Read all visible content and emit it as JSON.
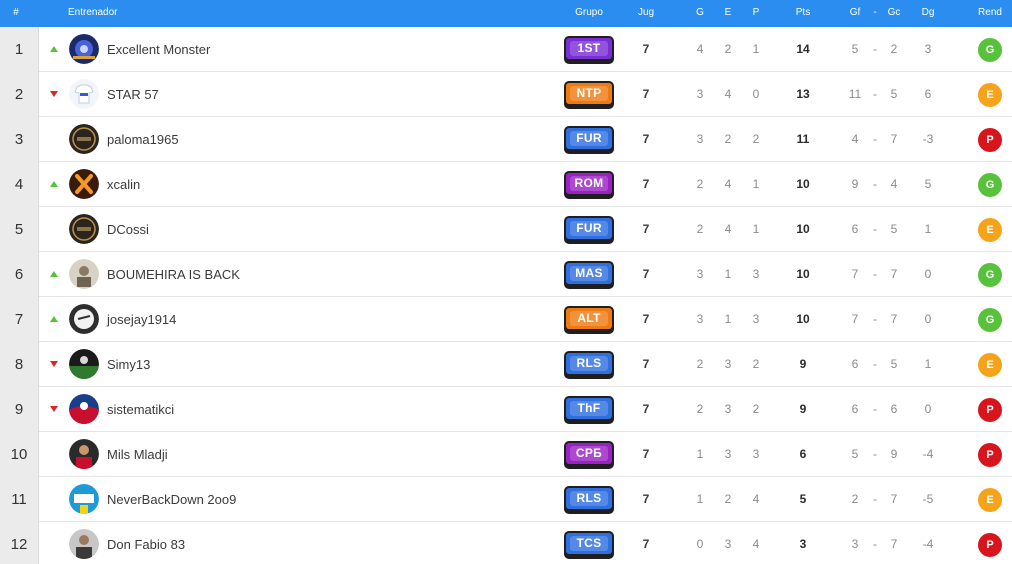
{
  "header": {
    "rank": "#",
    "coach": "Entrenador",
    "group": "Grupo",
    "played": "Jug",
    "won": "G",
    "drawn": "E",
    "lost": "P",
    "points": "Pts",
    "goals_for": "Gf",
    "dash": "-",
    "goals_against": "Gc",
    "goal_diff": "Dg",
    "performance": "Rend"
  },
  "colors": {
    "header_bg": "#2b8df0",
    "trend_up": "#58c23c",
    "trend_down": "#d82828",
    "rend_G": "#58c23c",
    "rend_E": "#f5a31a",
    "rend_P": "#d8141c"
  },
  "rows": [
    {
      "rank": "1",
      "trend": "up",
      "avatar": "monster-avatar",
      "name": "Excellent Monster",
      "group": "1ST",
      "group_color": "#7a2fd6",
      "played": "7",
      "won": "4",
      "drawn": "2",
      "lost": "1",
      "points": "14",
      "gf": "5",
      "dash": "-",
      "gc": "2",
      "dg": "3",
      "rend": "G"
    },
    {
      "rank": "2",
      "trend": "down",
      "avatar": "shirt-avatar",
      "name": "STAR 57",
      "group": "NTP",
      "group_color": "#f07a12",
      "played": "7",
      "won": "3",
      "drawn": "4",
      "lost": "0",
      "points": "13",
      "gf": "11",
      "dash": "-",
      "gc": "5",
      "dg": "6",
      "rend": "E"
    },
    {
      "rank": "3",
      "trend": "none",
      "avatar": "crest-avatar",
      "name": "paloma1965",
      "group": "FUR",
      "group_color": "#2f6fe0",
      "played": "7",
      "won": "3",
      "drawn": "2",
      "lost": "2",
      "points": "11",
      "gf": "4",
      "dash": "-",
      "gc": "7",
      "dg": "-3",
      "rend": "P"
    },
    {
      "rank": "4",
      "trend": "up",
      "avatar": "x-avatar",
      "name": "xcalin",
      "group": "ROM",
      "group_color": "#9a22c4",
      "played": "7",
      "won": "2",
      "drawn": "4",
      "lost": "1",
      "points": "10",
      "gf": "9",
      "dash": "-",
      "gc": "4",
      "dg": "5",
      "rend": "G"
    },
    {
      "rank": "5",
      "trend": "none",
      "avatar": "crest-avatar",
      "name": "DCossi",
      "group": "FUR",
      "group_color": "#2f6fe0",
      "played": "7",
      "won": "2",
      "drawn": "4",
      "lost": "1",
      "points": "10",
      "gf": "6",
      "dash": "-",
      "gc": "5",
      "dg": "1",
      "rend": "E"
    },
    {
      "rank": "6",
      "trend": "up",
      "avatar": "photo-avatar",
      "name": "BOUMEHIRA IS BACK",
      "group": "MAS",
      "group_color": "#2f6fe0",
      "played": "7",
      "won": "3",
      "drawn": "1",
      "lost": "3",
      "points": "10",
      "gf": "7",
      "dash": "-",
      "gc": "7",
      "dg": "0",
      "rend": "G"
    },
    {
      "rank": "7",
      "trend": "up",
      "avatar": "ball-avatar",
      "name": "josejay1914",
      "group": "ALT",
      "group_color": "#f07a12",
      "played": "7",
      "won": "3",
      "drawn": "1",
      "lost": "3",
      "points": "10",
      "gf": "7",
      "dash": "-",
      "gc": "7",
      "dg": "0",
      "rend": "G"
    },
    {
      "rank": "8",
      "trend": "down",
      "avatar": "pitch-avatar",
      "name": "Simy13",
      "group": "RLS",
      "group_color": "#2f6fe0",
      "played": "7",
      "won": "2",
      "drawn": "3",
      "lost": "2",
      "points": "9",
      "gf": "6",
      "dash": "-",
      "gc": "5",
      "dg": "1",
      "rend": "E"
    },
    {
      "rank": "9",
      "trend": "down",
      "avatar": "flag-avatar",
      "name": "sistematikci",
      "group": "ThF",
      "group_color": "#2f6fe0",
      "played": "7",
      "won": "2",
      "drawn": "3",
      "lost": "2",
      "points": "9",
      "gf": "6",
      "dash": "-",
      "gc": "6",
      "dg": "0",
      "rend": "P"
    },
    {
      "rank": "10",
      "trend": "none",
      "avatar": "player-avatar",
      "name": "Mils Mladji",
      "group": "СРБ",
      "group_color": "#9a22c4",
      "played": "7",
      "won": "1",
      "drawn": "3",
      "lost": "3",
      "points": "6",
      "gf": "5",
      "dash": "-",
      "gc": "9",
      "dg": "-4",
      "rend": "P"
    },
    {
      "rank": "11",
      "trend": "none",
      "avatar": "staff-avatar",
      "name": "NeverBackDown 2oo9",
      "group": "RLS",
      "group_color": "#2f6fe0",
      "played": "7",
      "won": "1",
      "drawn": "2",
      "lost": "4",
      "points": "5",
      "gf": "2",
      "dash": "-",
      "gc": "7",
      "dg": "-5",
      "rend": "E"
    },
    {
      "rank": "12",
      "trend": "none",
      "avatar": "man-avatar",
      "name": "Don Fabio 83",
      "group": "TCS",
      "group_color": "#2f6fe0",
      "played": "7",
      "won": "0",
      "drawn": "3",
      "lost": "4",
      "points": "3",
      "gf": "3",
      "dash": "-",
      "gc": "7",
      "dg": "-4",
      "rend": "P"
    }
  ]
}
